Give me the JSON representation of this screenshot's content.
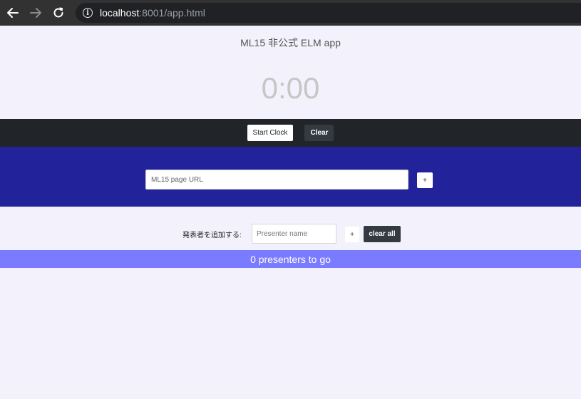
{
  "browser": {
    "back_icon": "arrow-left-icon",
    "forward_icon": "arrow-right-icon",
    "reload_icon": "reload-icon",
    "url_host": "localhost",
    "url_rest": ":8001/app.html"
  },
  "app": {
    "title": "ML15 非公式 ELM app",
    "clock": "0:00"
  },
  "controls": {
    "start_label": "Start Clock",
    "clear_label": "Clear"
  },
  "url_section": {
    "placeholder": "ML15 page URL",
    "add_label": "+"
  },
  "presenters": {
    "label": "発表者を追加する:",
    "placeholder": "Presenter name",
    "add_label": "+",
    "clear_all_label": "clear all",
    "status": "0 presenters to go"
  },
  "colors": {
    "page_bg": "#f3f2fc",
    "controls_bar": "#212529",
    "url_section_bg": "#22229b",
    "status_bar_bg": "#7b7bff"
  }
}
